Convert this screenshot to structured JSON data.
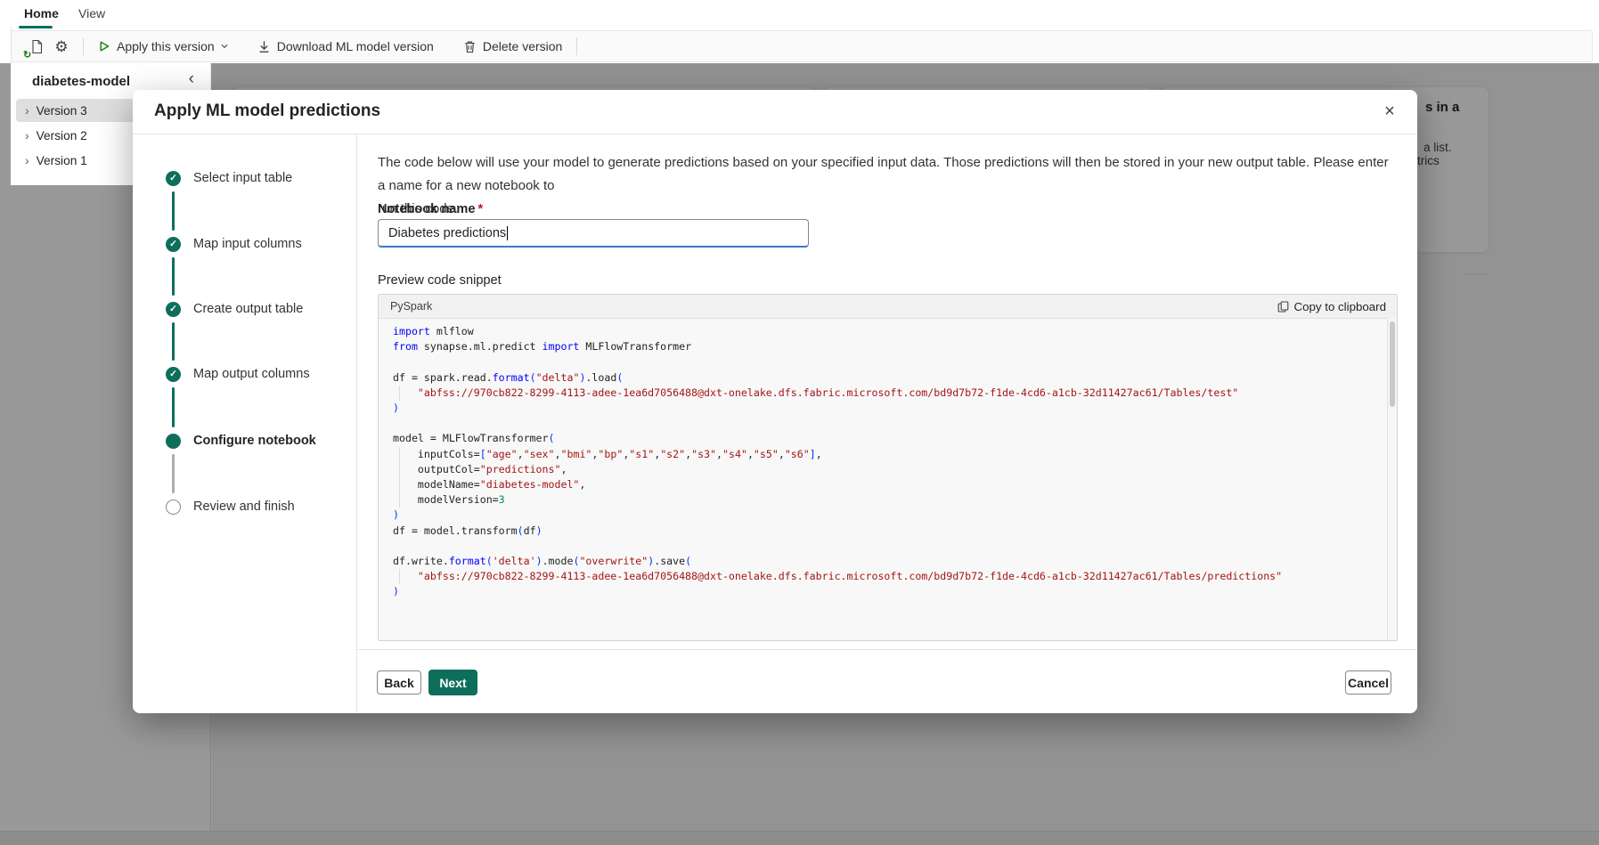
{
  "tabs": {
    "home": "Home",
    "view": "View"
  },
  "toolbar": {
    "apply_label": "Apply this version",
    "download_label": "Download ML model version",
    "delete_label": "Delete version"
  },
  "sidebar": {
    "title": "diabetes-model",
    "versions": [
      {
        "label": "Version 3",
        "selected": true
      },
      {
        "label": "Version 2",
        "selected": false
      },
      {
        "label": "Version 1",
        "selected": false
      }
    ]
  },
  "background": {
    "card3_bold": "s in a",
    "card3_line2": "a list.",
    "card3_line3": "trics"
  },
  "dialog": {
    "title": "Apply ML model predictions",
    "description_line1": "The code below will use your model to generate predictions based on your specified input data. Those predictions will then be stored in your new output table. Please enter a name for a new notebook to",
    "description_line2": "run this code.",
    "steps": [
      {
        "label": "Select input table",
        "state": "done"
      },
      {
        "label": "Map input columns",
        "state": "done"
      },
      {
        "label": "Create output table",
        "state": "done"
      },
      {
        "label": "Map output columns",
        "state": "done"
      },
      {
        "label": "Configure notebook",
        "state": "current"
      },
      {
        "label": "Review and finish",
        "state": "todo"
      }
    ],
    "notebook": {
      "label": "Notebook name",
      "required_mark": "*",
      "value": "Diabetes predictions"
    },
    "preview_label": "Preview code snippet",
    "code": {
      "language": "PySpark",
      "copy_label": "Copy to clipboard",
      "lines": [
        [
          [
            "k",
            "import"
          ],
          [
            "d",
            " mlflow"
          ]
        ],
        [
          [
            "k",
            "from"
          ],
          [
            "d",
            " synapse.ml.predict "
          ],
          [
            "k",
            "import"
          ],
          [
            "d",
            " MLFlowTransformer"
          ]
        ],
        [],
        [
          [
            "d",
            "df = spark.read."
          ],
          [
            "k",
            "format"
          ],
          [
            "p",
            "("
          ],
          [
            "s",
            "\"delta\""
          ],
          [
            "p",
            ")"
          ],
          [
            "d",
            ".load"
          ],
          [
            "p",
            "("
          ]
        ],
        [
          [
            "s",
            "    \"abfss://970cb822-8299-4113-adee-1ea6d7056488@dxt-onelake.dfs.fabric.microsoft.com/bd9d7b72-f1de-4cd6-a1cb-32d11427ac61/Tables/test\""
          ]
        ],
        [
          [
            "p",
            ")"
          ]
        ],
        [],
        [
          [
            "d",
            "model = MLFlowTransformer"
          ],
          [
            "p",
            "("
          ]
        ],
        [
          [
            "d",
            "    inputCols="
          ],
          [
            "p",
            "["
          ],
          [
            "s",
            "\"age\""
          ],
          [
            "d",
            ","
          ],
          [
            "s",
            "\"sex\""
          ],
          [
            "d",
            ","
          ],
          [
            "s",
            "\"bmi\""
          ],
          [
            "d",
            ","
          ],
          [
            "s",
            "\"bp\""
          ],
          [
            "d",
            ","
          ],
          [
            "s",
            "\"s1\""
          ],
          [
            "d",
            ","
          ],
          [
            "s",
            "\"s2\""
          ],
          [
            "d",
            ","
          ],
          [
            "s",
            "\"s3\""
          ],
          [
            "d",
            ","
          ],
          [
            "s",
            "\"s4\""
          ],
          [
            "d",
            ","
          ],
          [
            "s",
            "\"s5\""
          ],
          [
            "d",
            ","
          ],
          [
            "s",
            "\"s6\""
          ],
          [
            "p",
            "]"
          ],
          [
            "d",
            ","
          ]
        ],
        [
          [
            "d",
            "    outputCol="
          ],
          [
            "s",
            "\"predictions\""
          ],
          [
            "d",
            ","
          ]
        ],
        [
          [
            "d",
            "    modelName="
          ],
          [
            "s",
            "\"diabetes-model\""
          ],
          [
            "d",
            ","
          ]
        ],
        [
          [
            "d",
            "    modelVersion="
          ],
          [
            "n",
            "3"
          ]
        ],
        [
          [
            "p",
            ")"
          ]
        ],
        [
          [
            "d",
            "df = model.transform"
          ],
          [
            "p",
            "("
          ],
          [
            "d",
            "df"
          ],
          [
            "p",
            ")"
          ]
        ],
        [],
        [
          [
            "d",
            "df.write."
          ],
          [
            "k",
            "format"
          ],
          [
            "p",
            "("
          ],
          [
            "s",
            "'delta'"
          ],
          [
            "p",
            ")"
          ],
          [
            "d",
            ".mode"
          ],
          [
            "p",
            "("
          ],
          [
            "s",
            "\"overwrite\""
          ],
          [
            "p",
            ")"
          ],
          [
            "d",
            ".save"
          ],
          [
            "p",
            "("
          ]
        ],
        [
          [
            "s",
            "    \"abfss://970cb822-8299-4113-adee-1ea6d7056488@dxt-onelake.dfs.fabric.microsoft.com/bd9d7b72-f1de-4cd6-a1cb-32d11427ac61/Tables/predictions\""
          ]
        ],
        [
          [
            "p",
            ")"
          ]
        ]
      ]
    },
    "buttons": {
      "back": "Back",
      "next": "Next",
      "cancel": "Cancel"
    }
  },
  "icons": {
    "close": "×",
    "gear": "⚙",
    "refresh": "↻",
    "collapse_chevron": "‹",
    "expand_chevron": "›",
    "checkmark": "✓"
  },
  "colors": {
    "brand_teal": "#0e6e5c",
    "run_green": "#107c10",
    "required_red": "#c50f1f",
    "focus_blue": "#3b78cc",
    "code_keyword": "#0000ff",
    "code_string": "#a31515",
    "code_number": "#098658",
    "code_paren": "#0431fa"
  }
}
